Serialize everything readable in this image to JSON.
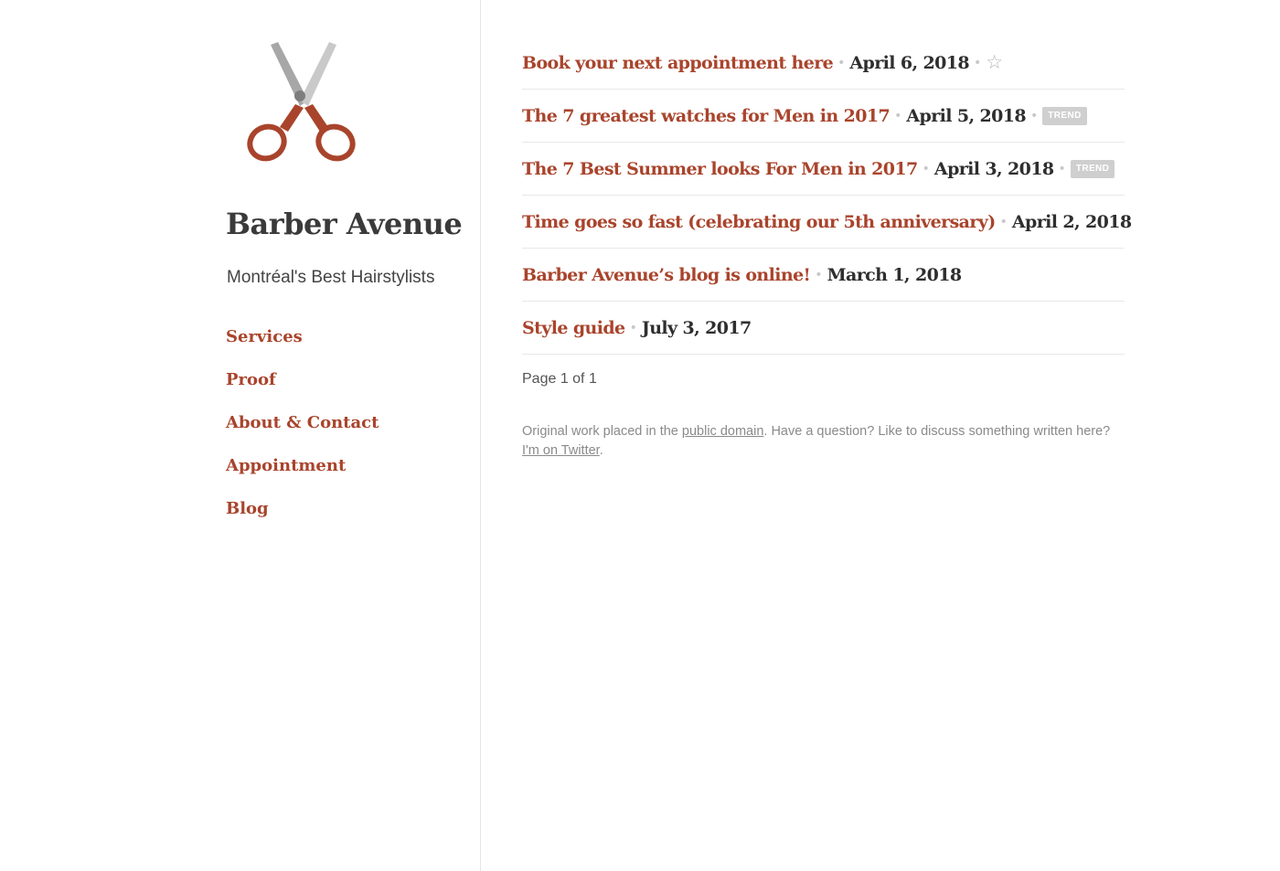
{
  "site": {
    "title": "Barber Avenue",
    "tagline": "Montréal's Best Hairstylists",
    "logo_icon": "scissors-icon",
    "accent_color": "#a9442c"
  },
  "nav": {
    "items": [
      {
        "label": "Services"
      },
      {
        "label": "Proof"
      },
      {
        "label": "About & Contact"
      },
      {
        "label": "Appointment"
      },
      {
        "label": "Blog"
      }
    ]
  },
  "posts": [
    {
      "title": "Book your next appointment here",
      "date": "April 6, 2018",
      "extra": "star-icon"
    },
    {
      "title": "The 7 greatest watches for Men in 2017",
      "date": "April 5, 2018",
      "badge": "TREND"
    },
    {
      "title": "The 7 Best Summer looks For Men in 2017",
      "date": "April 3, 2018",
      "badge": "TREND"
    },
    {
      "title": "Time goes so fast (celebrating our 5th anniversary)",
      "date": "April 2, 2018"
    },
    {
      "title": "Barber Avenue’s blog is online!",
      "date": "March 1, 2018"
    },
    {
      "title": "Style guide",
      "date": "July 3, 2017"
    }
  ],
  "pagination": {
    "text": "Page 1 of 1"
  },
  "footer": {
    "text1": "Original work placed in the ",
    "link1": "public domain",
    "text2": ". Have a question? Like to discuss something written here? ",
    "link2": "I'm on Twitter",
    "text3": "."
  },
  "separator": "•",
  "star_glyph": "☆"
}
